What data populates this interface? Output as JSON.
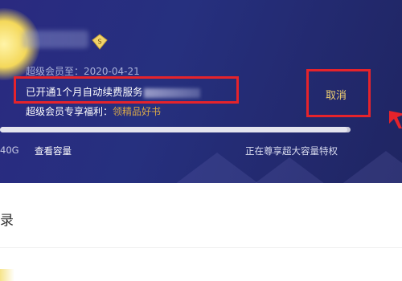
{
  "member": {
    "expire_label": "超级会员至：2020-04-21",
    "auto_renew_text": "已开通1个月自动续费服务",
    "benefit_label": "超级会员专享福利：",
    "benefit_link": "领精品好书",
    "cancel_label": "取消"
  },
  "storage": {
    "used_suffix": "40G",
    "view_capacity_label": "查看容量",
    "status_text": "正在尊享超大容量特权",
    "progress_fraction": 0.99
  },
  "section": {
    "title": "录"
  },
  "colors": {
    "banner": "#26307f",
    "highlight_box": "#e6232b",
    "cancel_text": "#f0d070",
    "benefit_link": "#d8a84a"
  },
  "icons": {
    "badge": "svip-diamond-icon",
    "arrow": "red-arrow-icon"
  }
}
